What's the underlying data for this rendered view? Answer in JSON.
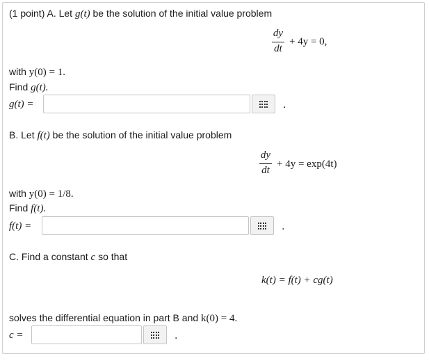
{
  "partA": {
    "intro": "(1 point) A. Let ",
    "fn_g": "g(t)",
    "intro_rest": " be the solution of the initial value problem",
    "eq_num": "dy",
    "eq_den": "dt",
    "eq_rest": "+ 4y = 0,",
    "with_prefix": "with ",
    "with_math": "y(0) = 1.",
    "find_prefix": "Find ",
    "find_math": "g(t).",
    "label": "g(t) =",
    "value": "",
    "after": "."
  },
  "partB": {
    "intro": "B. Let ",
    "fn_f": "f(t)",
    "intro_rest": " be the solution of the initial value problem",
    "eq_num": "dy",
    "eq_den": "dt",
    "eq_rest": "+ 4y = exp(4t)",
    "with_prefix": "with ",
    "with_math": "y(0) = 1/8.",
    "find_prefix": "Find ",
    "find_math": "f(t).",
    "label": "f(t) =",
    "value": "",
    "after": "."
  },
  "partC": {
    "intro": "C. Find a constant ",
    "const": "c",
    "intro_rest": " so that",
    "eq": "k(t) = f(t) + cg(t)",
    "solves": "solves the differential equation in part B and ",
    "solves_math": "k(0) = 4.",
    "label": "c =",
    "value": "",
    "after": "."
  },
  "icons": {
    "palette": "equation-palette-icon"
  }
}
